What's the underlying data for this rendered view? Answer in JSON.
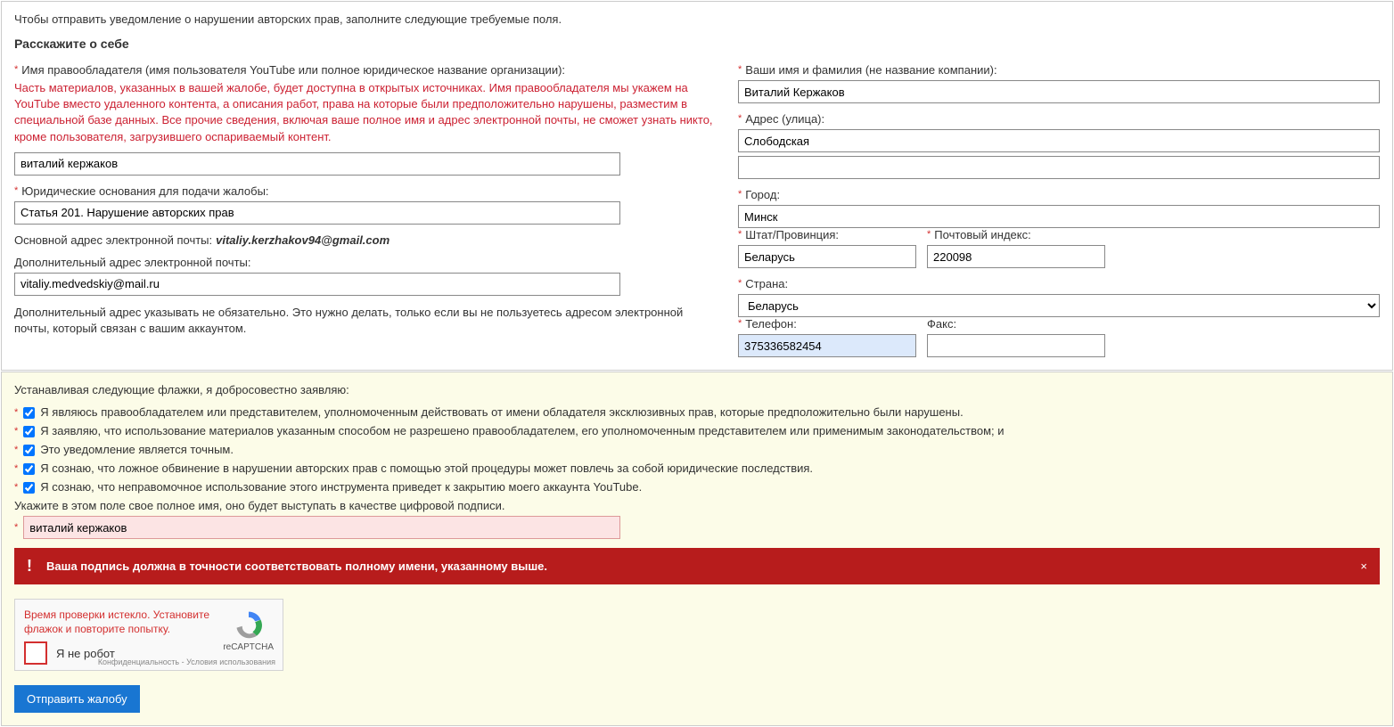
{
  "top": {
    "instruction": "Чтобы отправить уведомление о нарушении авторских прав, заполните следующие требуемые поля.",
    "about_header": "Расскажите о себе",
    "left": {
      "owner_label": "Имя правообладателя (имя пользователя YouTube или полное юридическое название организации):",
      "owner_warn": "Часть материалов, указанных в вашей жалобе, будет доступна в открытых источниках. Имя правообладателя мы укажем на YouTube вместо удаленного контента, а описания работ, права на которые были предположительно нарушены, разместим в специальной базе данных. Все прочие сведения, включая ваше полное имя и адрес электронной почты, не сможет узнать никто, кроме пользователя, загрузившего оспариваемый контент.",
      "owner_value": "виталий кержаков",
      "legal_basis_label": "Юридические основания для подачи жалобы:",
      "legal_basis_value": "Статья 201. Нарушение авторских прав",
      "primary_email_label": "Основной адрес электронной почты:",
      "primary_email_value": "vitaliy.kerzhakov94@gmail.com",
      "alt_email_label": "Дополнительный адрес электронной почты:",
      "alt_email_value": "vitaliy.medvedskiy@mail.ru",
      "alt_email_note": "Дополнительный адрес указывать не обязательно. Это нужно делать, только если вы не пользуетесь адресом электронной почты, который связан с вашим аккаунтом."
    },
    "right": {
      "name_label": "Ваши имя и фамилия (не название компании):",
      "name_value": "Виталий Кержаков",
      "address_label": "Адрес (улица):",
      "address_value": "Слободская",
      "address2_value": "",
      "city_label": "Город:",
      "city_value": "Минск",
      "state_label": "Штат/Провинция:",
      "state_value": "Беларусь",
      "zip_label": "Почтовый индекс:",
      "zip_value": "220098",
      "country_label": "Страна:",
      "country_value": "Беларусь",
      "phone_label": "Телефон:",
      "phone_value": "375336582454",
      "fax_label": "Факс:",
      "fax_value": ""
    }
  },
  "bottom": {
    "decl_header": "Устанавливая следующие флажки, я добросовестно заявляю:",
    "decls": [
      "Я являюсь правообладателем или представителем, уполномоченным действовать от имени обладателя эксклюзивных прав, которые предположительно были нарушены.",
      "Я заявляю, что использование материалов указанным способом не разрешено правообладателем, его уполномоченным представителем или применимым законодательством; и",
      "Это уведомление является точным.",
      "Я сознаю, что ложное обвинение в нарушении авторских прав с помощью этой процедуры может повлечь за собой юридические последствия.",
      "Я сознаю, что неправомочное использование этого инструмента приведет к закрытию моего аккаунта YouTube."
    ],
    "sig_label": "Укажите в этом поле свое полное имя, оно будет выступать в качестве цифровой подписи.",
    "sig_value": "виталий кержаков",
    "error_msg": "Ваша подпись должна в точности соответствовать полному имени, указанному выше.",
    "captcha": {
      "expired": "Время проверки истекло. Установите флажок и повторите попытку.",
      "label": "Я не робот",
      "brand": "reCAPTCHA",
      "legal": "Конфиденциальность - Условия использования"
    },
    "submit": "Отправить жалобу"
  }
}
